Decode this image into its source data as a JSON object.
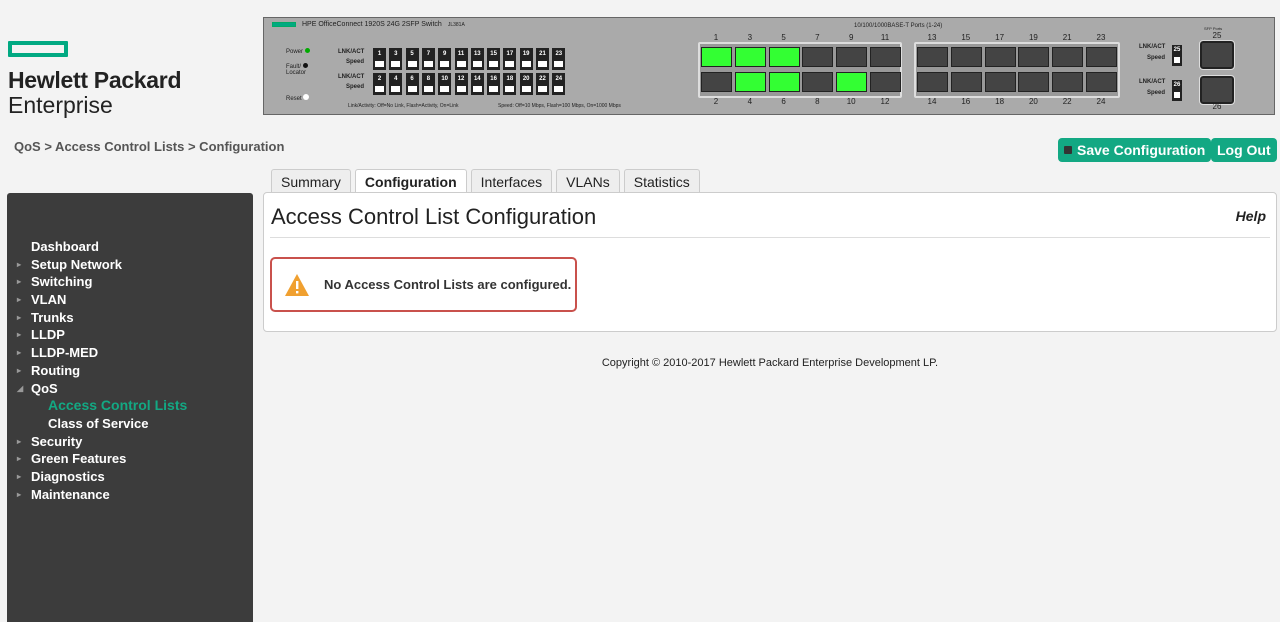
{
  "logo": {
    "line1": "Hewlett Packard",
    "line2": "Enterprise"
  },
  "switch": {
    "model": "HPE OfficeConnect 1920S 24G 2SFP Switch",
    "sku": "JL381A",
    "power_label": "Power",
    "fault_label": "Fault/",
    "locator_label": "Locator",
    "reset_label": "Reset",
    "lnk_label": "LNK/ACT",
    "speed_label": "Speed",
    "legend_link": "Link/Activity: Off=No Link, Flash=Activity, On=Link",
    "legend_speed": "Speed: Off=10 Mbps, Flash=100 Mbps, On=1000 Mbps",
    "ports_title": "10/100/1000BASE-T Ports (1-24)",
    "sfp_title": "SFP Ports",
    "top_ports": [
      "1",
      "3",
      "5",
      "7",
      "9",
      "11",
      "13",
      "15",
      "17",
      "19",
      "21",
      "23"
    ],
    "bottom_ports": [
      "2",
      "4",
      "6",
      "8",
      "10",
      "12",
      "14",
      "16",
      "18",
      "20",
      "22",
      "24"
    ],
    "sfp_ports": [
      "25",
      "26"
    ],
    "active_ports": [
      "1",
      "3",
      "5",
      "4",
      "6",
      "10"
    ],
    "active_color": "#33ff33"
  },
  "breadcrumb": "QoS > Access Control Lists > Configuration",
  "header": {
    "save_label": "Save Configuration",
    "logout_label": "Log Out"
  },
  "sidebar": {
    "items": [
      {
        "label": "Dashboard",
        "arrow": ""
      },
      {
        "label": "Setup Network",
        "arrow": "▸"
      },
      {
        "label": "Switching",
        "arrow": "▸"
      },
      {
        "label": "VLAN",
        "arrow": "▸"
      },
      {
        "label": "Trunks",
        "arrow": "▸"
      },
      {
        "label": "LLDP",
        "arrow": "▸"
      },
      {
        "label": "LLDP-MED",
        "arrow": "▸"
      },
      {
        "label": "Routing",
        "arrow": "▸"
      },
      {
        "label": "QoS",
        "arrow": "◢"
      },
      {
        "label": "Access Control Lists",
        "arrow": "",
        "sub": true,
        "active": true
      },
      {
        "label": "Class of Service",
        "arrow": "",
        "sub": true
      },
      {
        "label": "Security",
        "arrow": "▸"
      },
      {
        "label": "Green Features",
        "arrow": "▸"
      },
      {
        "label": "Diagnostics",
        "arrow": "▸"
      },
      {
        "label": "Maintenance",
        "arrow": "▸"
      }
    ]
  },
  "tabs": [
    {
      "label": "Summary"
    },
    {
      "label": "Configuration",
      "selected": true
    },
    {
      "label": "Interfaces"
    },
    {
      "label": "VLANs"
    },
    {
      "label": "Statistics"
    }
  ],
  "content": {
    "title": "Access Control List Configuration",
    "help": "Help",
    "alert": "No Access Control Lists are configured."
  },
  "footer": "Copyright © 2010-2017 Hewlett Packard Enterprise Development LP.",
  "colors": {
    "accent": "#13a883",
    "alert_border": "#c9514c",
    "warning": "#f0a030",
    "sidebar_bg": "#3c3c3c"
  }
}
